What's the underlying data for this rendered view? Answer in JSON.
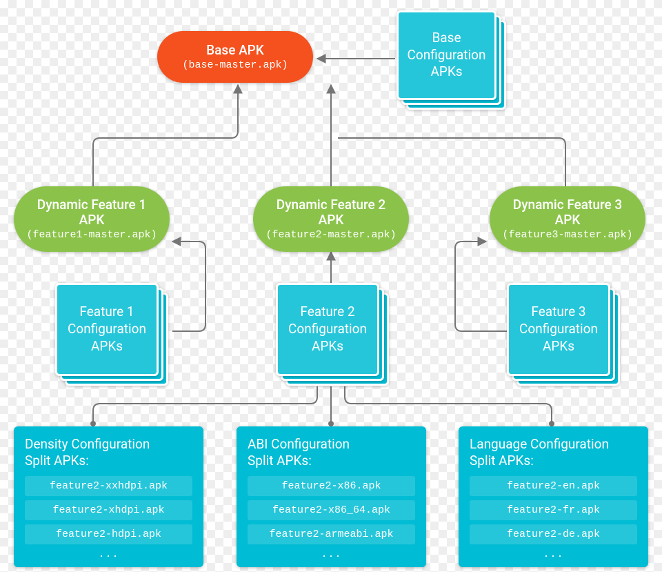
{
  "base": {
    "title": "Base APK",
    "file": "(base-master.apk)"
  },
  "baseConfig": {
    "line1": "Base",
    "line2": "Configuration",
    "line3": "APKs"
  },
  "features": [
    {
      "title_l1": "Dynamic Feature 1",
      "title_l2": "APK",
      "file": "(feature1-master.apk)"
    },
    {
      "title_l1": "Dynamic Feature 2",
      "title_l2": "APK",
      "file": "(feature2-master.apk)"
    },
    {
      "title_l1": "Dynamic Feature 3",
      "title_l2": "APK",
      "file": "(feature3-master.apk)"
    }
  ],
  "featureConfigs": [
    {
      "line1": "Feature 1",
      "line2": "Configuration",
      "line3": "APKs"
    },
    {
      "line1": "Feature 2",
      "line2": "Configuration",
      "line3": "APKs"
    },
    {
      "line1": "Feature 3",
      "line2": "Configuration",
      "line3": "APKs"
    }
  ],
  "splits": {
    "density": {
      "title_l1": "Density Configuration",
      "title_l2": "Split APKs:",
      "entries": [
        "feature2-xxhdpi.apk",
        "feature2-xhdpi.apk",
        "feature2-hdpi.apk"
      ],
      "more": "..."
    },
    "abi": {
      "title_l1": "ABI Configuration",
      "title_l2": "Split APKs:",
      "entries": [
        "feature2-x86.apk",
        "feature2-x86_64.apk",
        "feature2-armeabi.apk"
      ],
      "more": "..."
    },
    "language": {
      "title_l1": "Language Configuration",
      "title_l2": "Split APKs:",
      "entries": [
        "feature2-en.apk",
        "feature2-fr.apk",
        "feature2-de.apk"
      ],
      "more": "..."
    }
  }
}
